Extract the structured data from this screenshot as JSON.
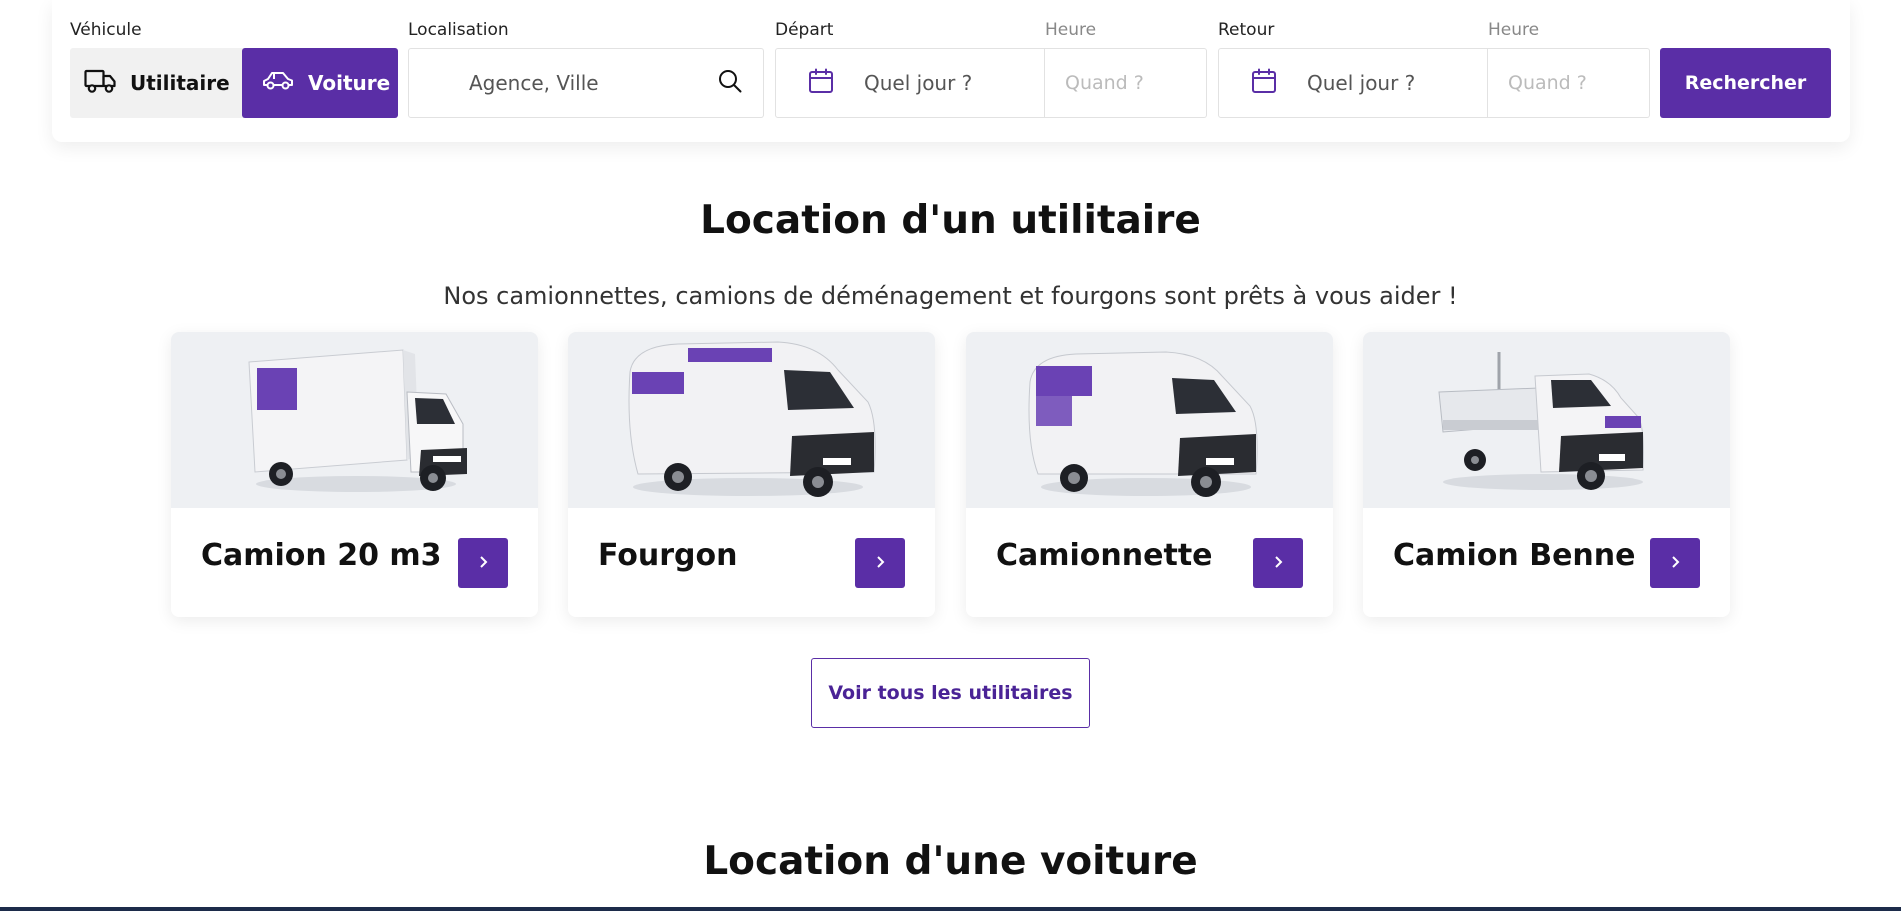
{
  "search": {
    "vehicle_label": "Véhicule",
    "vehicle_options": [
      "Utilitaire",
      "Voiture"
    ],
    "selected_vehicle": "Voiture",
    "location_label": "Localisation",
    "location_placeholder": "Agence, Ville",
    "departure_label": "Départ",
    "departure_date_placeholder": "Quel jour ?",
    "departure_time_label": "Heure",
    "departure_time_placeholder": "Quand ?",
    "return_label": "Retour",
    "return_date_placeholder": "Quel jour ?",
    "return_time_label": "Heure",
    "return_time_placeholder": "Quand ?",
    "search_button": "Rechercher"
  },
  "utility_section": {
    "title": "Location d'un utilitaire",
    "subtitle": "Nos camionnettes, camions de déménagement et fourgons sont prêts à vous aider !",
    "cards": [
      {
        "title": "Camion 20 m3",
        "image": "box-truck"
      },
      {
        "title": "Fourgon",
        "image": "large-van"
      },
      {
        "title": "Camionnette",
        "image": "small-van"
      },
      {
        "title": "Camion Benne",
        "image": "tipper-truck"
      }
    ],
    "view_all_button": "Voir tous les utilitaires"
  },
  "car_section": {
    "title": "Location d'une voiture"
  },
  "colors": {
    "brand_purple": "#5a2ea6",
    "card_image_bg": "#eef0f3"
  },
  "icons": {
    "utility": "truck-icon",
    "car": "car-icon",
    "search": "search-icon",
    "calendar": "calendar-icon",
    "arrow": "chevron-right-icon"
  }
}
